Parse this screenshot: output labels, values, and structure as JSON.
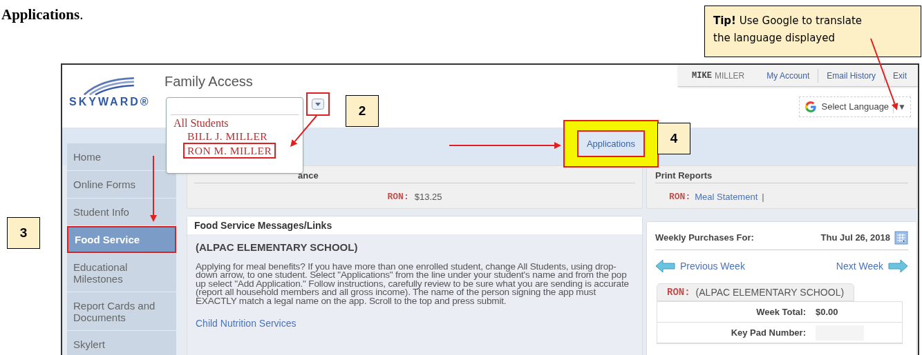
{
  "caption": "**Applications**.",
  "tip": "**Tip!**  Use Google to translate the language displayed",
  "callouts": [
    "2",
    "3",
    "4"
  ],
  "app": {
    "logo": "SKYWARD®",
    "title": "Family Access",
    "user": {
      "first": "MIKE",
      "last": "MILLER"
    },
    "top_links": [
      "My Account",
      "Email History",
      "Exit"
    ],
    "language": {
      "label": "Select Language",
      "caret": "▼"
    },
    "student_options": [
      {
        "label": "All Students",
        "selected": false
      },
      {
        "label": "BILL J. MILLER",
        "selected": false
      },
      {
        "label": "RON M. MILLER",
        "selected": true
      }
    ],
    "nav_link": "Applications",
    "sidebar": [
      {
        "label": "Home",
        "selected": false
      },
      {
        "label": "Online Forms",
        "selected": false
      },
      {
        "label": "Student Info",
        "selected": false
      },
      {
        "label": "Food Service",
        "selected": true
      },
      {
        "label": "Educational Milestones",
        "selected": false
      },
      {
        "label": "Report Cards and Documents",
        "selected": false
      },
      {
        "label": "Skylert",
        "selected": false
      }
    ],
    "balance": {
      "title": "ance",
      "student": "RON:",
      "amount": "$13.25"
    },
    "messages": {
      "title": "Food Service Messages/Links",
      "school": "(ALPAC ELEMENTARY SCHOOL)",
      "body": "Applying for meal benefits? If you have more than one enrolled student, change All Students, using drop-down arrow, to one student. Select \"Applications\" from the line under your student's name and from the pop up select \"Add Application.\" Follow instructions, carefully review to be sure what you are sending is accurate (report all household members and all gross income). The name of the person signing the app must EXACTLY match a legal name on the app. Scroll to the top and press submit.",
      "link": "Child Nutrition Services"
    },
    "print_reports": {
      "title": "Print Reports",
      "student": "RON:",
      "link": "Meal Statement",
      "separator": "|"
    },
    "weekly": {
      "title": "Weekly Purchases For:",
      "date": "Thu Jul 26, 2018",
      "prev": "Previous Week",
      "next": "Next Week",
      "tab_student": "RON:",
      "tab_school": "(ALPAC ELEMENTARY SCHOOL)",
      "rows": [
        {
          "label": "Week Total:",
          "value": "$0.00"
        },
        {
          "label": "Key Pad Number:"
        }
      ]
    }
  }
}
